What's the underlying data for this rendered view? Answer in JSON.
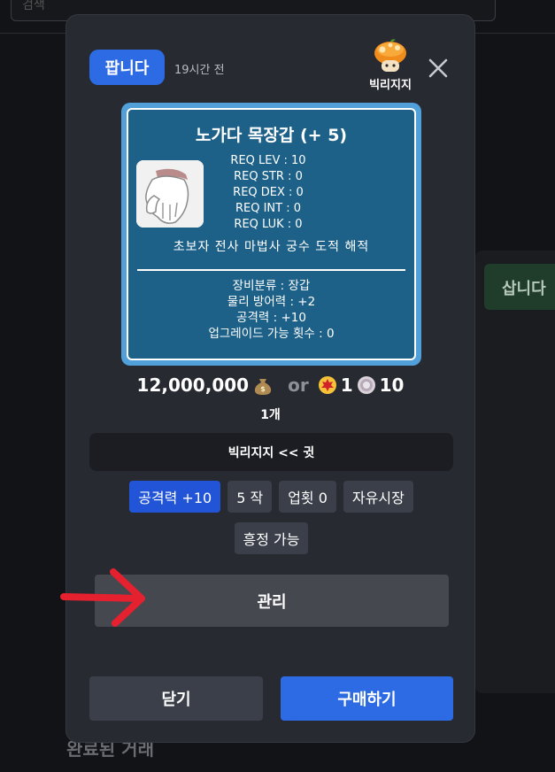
{
  "background": {
    "search_text": "검색",
    "buy_tab_label": "삽니다",
    "completed_title": "완료된 거래"
  },
  "modal": {
    "badge": "팝니다",
    "time_ago": "19시간 전",
    "seller_name": "빅리지지",
    "close_icon": "close-icon"
  },
  "item": {
    "name": "노가다 목장갑 (+ 5)",
    "requirements": [
      "REQ LEV : 10",
      "REQ STR : 0",
      "REQ DEX : 0",
      "REQ INT : 0",
      "REQ LUK : 0"
    ],
    "jobs": "초보자 전사 마법사 궁수 도적 해적",
    "stats": [
      "장비분류 : 장갑",
      "물리 방어력 : +2",
      "공격력 : +10",
      "업그레이드 가능 횟수 : 0"
    ]
  },
  "price": {
    "mesos": "12,000,000",
    "or_label": "or",
    "maple_point": "1",
    "coin": "10",
    "quantity": "1개"
  },
  "message": "빅리지지 << 귓",
  "tags_row1": [
    "공격력 +10",
    "5 작",
    "업횟 0",
    "자유시장"
  ],
  "tags_row2": [
    "흥정 가능"
  ],
  "buttons": {
    "manage": "관리",
    "close": "닫기",
    "buy": "구매하기"
  },
  "colors": {
    "accent_blue": "#2d6be4",
    "item_bg": "#1d6189",
    "arrow_red": "#e5202f"
  }
}
